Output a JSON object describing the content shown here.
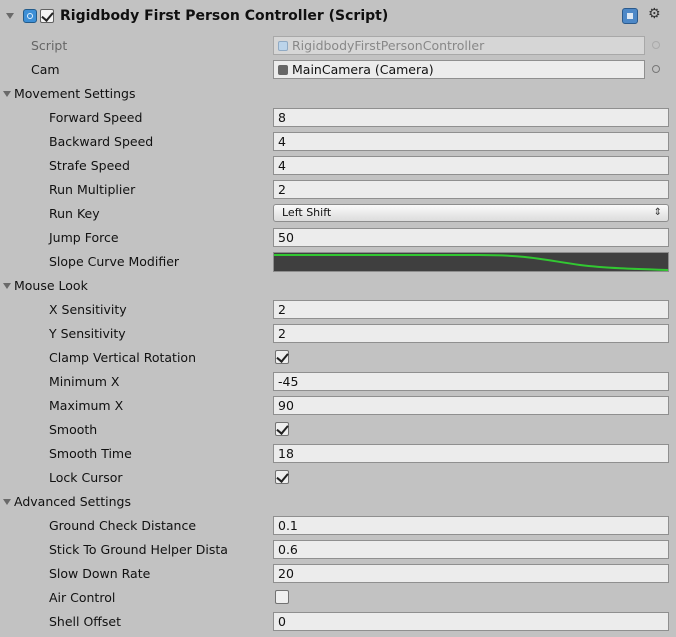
{
  "component": {
    "title": "Rigidbody First Person Controller (Script)",
    "script": {
      "label": "Script",
      "value": "RigidbodyFirstPersonController"
    },
    "cam": {
      "label": "Cam",
      "value": "MainCamera (Camera)"
    }
  },
  "movement": {
    "title": "Movement Settings",
    "forward_speed": {
      "label": "Forward Speed",
      "value": "8"
    },
    "backward_speed": {
      "label": "Backward Speed",
      "value": "4"
    },
    "strafe_speed": {
      "label": "Strafe Speed",
      "value": "4"
    },
    "run_multiplier": {
      "label": "Run Multiplier",
      "value": "2"
    },
    "run_key": {
      "label": "Run Key",
      "value": "Left Shift"
    },
    "jump_force": {
      "label": "Jump Force",
      "value": "50"
    },
    "slope_curve": {
      "label": "Slope Curve Modifier"
    }
  },
  "mouse_look": {
    "title": "Mouse Look",
    "x_sensitivity": {
      "label": "X Sensitivity",
      "value": "2"
    },
    "y_sensitivity": {
      "label": "Y Sensitivity",
      "value": "2"
    },
    "clamp_vertical_rotation": {
      "label": "Clamp Vertical Rotation",
      "checked": true
    },
    "minimum_x": {
      "label": "Minimum X",
      "value": "-45"
    },
    "maximum_x": {
      "label": "Maximum X",
      "value": "90"
    },
    "smooth": {
      "label": "Smooth",
      "checked": true
    },
    "smooth_time": {
      "label": "Smooth Time",
      "value": "18"
    },
    "lock_cursor": {
      "label": "Lock Cursor",
      "checked": true
    }
  },
  "advanced": {
    "title": "Advanced Settings",
    "ground_check_distance": {
      "label": "Ground Check Distance",
      "value": "0.1"
    },
    "stick_to_ground": {
      "label": "Stick To Ground Helper Dista",
      "value": "0.6"
    },
    "slow_down_rate": {
      "label": "Slow Down Rate",
      "value": "20"
    },
    "air_control": {
      "label": "Air Control",
      "checked": false
    },
    "shell_offset": {
      "label": "Shell Offset",
      "value": "0"
    }
  },
  "icons": {
    "foldout": "triangle-down-icon",
    "script": "script-icon",
    "help": "help-icon",
    "gear": "gear-icon",
    "object_picker": "object-picker-icon",
    "dropdown": "dropdown-arrow-icon",
    "camera": "camera-icon"
  },
  "colors": {
    "background": "#c2c2c2",
    "field": "#ececec",
    "curve_background": "#3f3f3f",
    "curve_line": "#32c832"
  }
}
